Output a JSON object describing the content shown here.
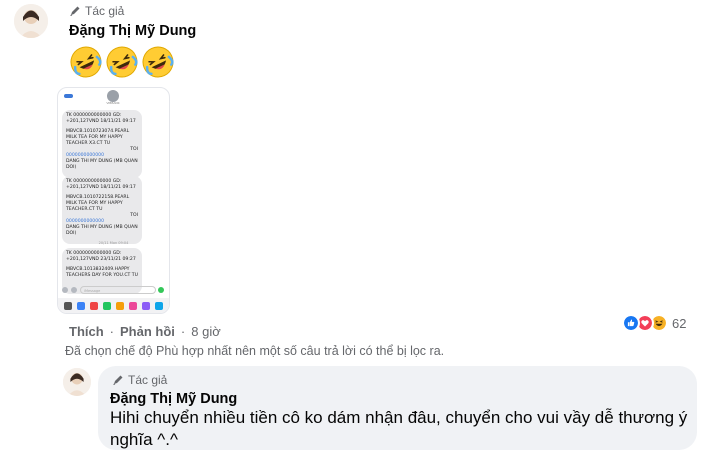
{
  "comment": {
    "author_tag": "Tác giả",
    "author_name": "Đặng Thị Mỹ Dung",
    "emoji_count": 3,
    "emoji_name": "rolling-on-floor-laughing",
    "attachment": {
      "contact_name": "VIBBANK",
      "messages": [
        {
          "account_line": "TK 0000000000000 GD:",
          "amount_line": "+201,127VND 18/11/21 09:17",
          "detail": "MBVCB.1010723074.PEARL MILK TEA FOR MY HAPPY TEACHER X3.CT TU",
          "to_line": "TOI",
          "acct2": "0000000000000",
          "recipient": "DANG THI MY DUNG (MB QUAN DOI)"
        },
        {
          "account_line": "TK 0000000000000 GD:",
          "amount_line": "+201,127VND 18/11/21 09:17",
          "detail": "MBVCB.1010722158.PEARL MILK TEA FOR MY HAPPY TEACHER.CT TU",
          "to_line": "TOI",
          "acct2": "0000000000000",
          "recipient": "DANG THI MY DUNG (MB QUAN DOI)"
        },
        {
          "account_line": "TK 0000000000000 GD:",
          "amount_line": "+201,127VND 23/11/21 09:27",
          "detail": "MBVCB.1013832409.HAPPY TEACHERS DAY FOR YOU.CT TU",
          "to_line": "",
          "acct2": "",
          "recipient": ""
        }
      ],
      "date_divider": "20/11 Mon 09:04",
      "input_placeholder": "iMessage"
    },
    "actions": {
      "like": "Thích",
      "reply": "Phản hồi",
      "separator": "·",
      "time": "8 giờ"
    },
    "reactions": {
      "count": "62",
      "types": [
        "like",
        "love",
        "haha"
      ]
    },
    "filter_notice": "Đã chọn chế độ Phù hợp nhất nên một số câu trả lời có thể bị lọc ra."
  },
  "reply": {
    "author_tag": "Tác giả",
    "author_name": "Đặng Thị Mỹ Dung",
    "text": "Hihi chuyển nhiều tiền cô ko dám nhận đâu, chuyển cho vui vầy dễ thương ý nghĩa ^.^"
  },
  "colors": {
    "like_blue": "#1877f2",
    "love_red": "#f33e58",
    "haha_yellow": "#f7b125",
    "meta_gray": "#65676b",
    "bubble_bg": "#f0f2f5"
  }
}
